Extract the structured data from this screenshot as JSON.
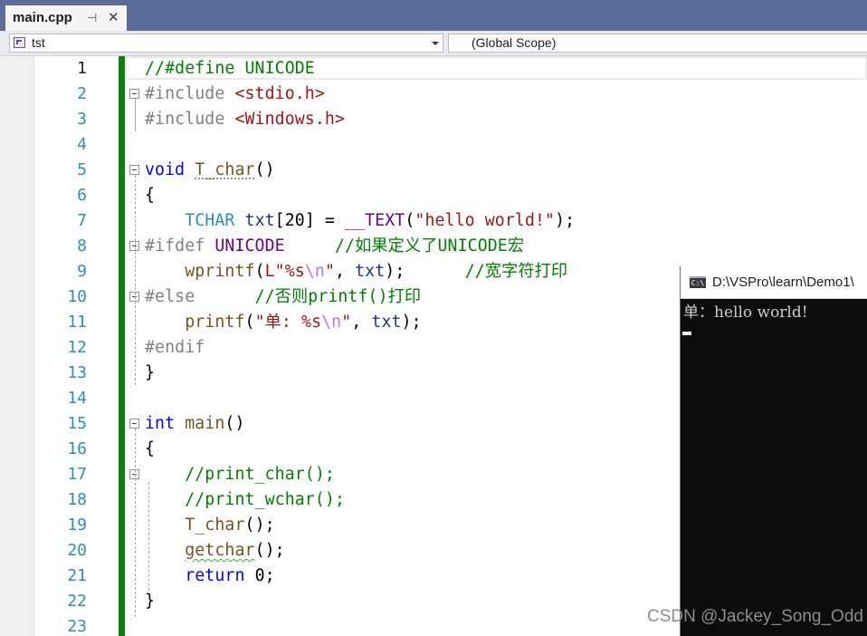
{
  "tab": {
    "title": "main.cpp",
    "pin_icon": "pin-icon",
    "close_icon": "close-icon"
  },
  "nav": {
    "project": "tst",
    "scope": "(Global Scope)"
  },
  "editor": {
    "current_line": 1,
    "lines": [
      {
        "n": "1",
        "fold": false,
        "tokens": [
          [
            "//#define UNICODE",
            "cm"
          ]
        ]
      },
      {
        "n": "2",
        "fold": true,
        "tokens": [
          [
            "#include ",
            "pp"
          ],
          [
            "<stdio.h>",
            "str"
          ]
        ]
      },
      {
        "n": "3",
        "fold": false,
        "tokens": [
          [
            "#include ",
            "pp"
          ],
          [
            "<Windows.h>",
            "str"
          ]
        ]
      },
      {
        "n": "4",
        "fold": false,
        "tokens": []
      },
      {
        "n": "5",
        "fold": true,
        "tokens": [
          [
            "void",
            "kw"
          ],
          [
            " ",
            "pl"
          ],
          [
            "T_char",
            "fn dot"
          ],
          [
            "()",
            "pl"
          ]
        ]
      },
      {
        "n": "6",
        "fold": false,
        "tokens": [
          [
            "{",
            "pl"
          ]
        ]
      },
      {
        "n": "7",
        "fold": false,
        "tokens": [
          [
            "    ",
            "pl"
          ],
          [
            "TCHAR",
            "typ"
          ],
          [
            " ",
            "pl"
          ],
          [
            "txt",
            "id"
          ],
          [
            "[20] = ",
            "pl"
          ],
          [
            "__TEXT",
            "mac"
          ],
          [
            "(",
            "pl"
          ],
          [
            "\"hello world!\"",
            "str"
          ],
          [
            ");",
            "pl"
          ]
        ]
      },
      {
        "n": "8",
        "fold": true,
        "tokens": [
          [
            "#ifdef ",
            "pp"
          ],
          [
            "UNICODE",
            "mac"
          ],
          [
            "     ",
            "pl"
          ],
          [
            "//如果定义了UNICODE宏",
            "cm"
          ]
        ]
      },
      {
        "n": "9",
        "fold": false,
        "tokens": [
          [
            "    ",
            "pl"
          ],
          [
            "wprintf",
            "fn"
          ],
          [
            "(",
            "pl"
          ],
          [
            "L\"%s",
            "str"
          ],
          [
            "\\n",
            "esc"
          ],
          [
            "\"",
            "str"
          ],
          [
            ", ",
            "pl"
          ],
          [
            "txt",
            "id"
          ],
          [
            ");",
            "pl"
          ],
          [
            "      ",
            "pl"
          ],
          [
            "//宽字符打印",
            "cm"
          ]
        ]
      },
      {
        "n": "10",
        "fold": true,
        "tokens": [
          [
            "#else",
            "pp"
          ],
          [
            "      ",
            "pl"
          ],
          [
            "//否则printf()打印",
            "cm"
          ]
        ]
      },
      {
        "n": "11",
        "fold": false,
        "tokens": [
          [
            "    ",
            "pl"
          ],
          [
            "printf",
            "fn"
          ],
          [
            "(",
            "pl"
          ],
          [
            "\"单: %s",
            "str"
          ],
          [
            "\\n",
            "esc"
          ],
          [
            "\"",
            "str"
          ],
          [
            ", ",
            "pl"
          ],
          [
            "txt",
            "id"
          ],
          [
            ");",
            "pl"
          ]
        ]
      },
      {
        "n": "12",
        "fold": false,
        "tokens": [
          [
            "#endif",
            "pp"
          ]
        ]
      },
      {
        "n": "13",
        "fold": false,
        "tokens": [
          [
            "}",
            "pl"
          ]
        ]
      },
      {
        "n": "14",
        "fold": false,
        "tokens": []
      },
      {
        "n": "15",
        "fold": true,
        "tokens": [
          [
            "int",
            "kw"
          ],
          [
            " ",
            "pl"
          ],
          [
            "main",
            "fn"
          ],
          [
            "()",
            "pl"
          ]
        ]
      },
      {
        "n": "16",
        "fold": false,
        "tokens": [
          [
            "{",
            "pl"
          ]
        ]
      },
      {
        "n": "17",
        "fold": true,
        "tokens": [
          [
            "    ",
            "pl"
          ],
          [
            "//print_char();",
            "cm"
          ]
        ]
      },
      {
        "n": "18",
        "fold": false,
        "tokens": [
          [
            "    ",
            "pl"
          ],
          [
            "//print_wchar();",
            "cm"
          ]
        ]
      },
      {
        "n": "19",
        "fold": false,
        "tokens": [
          [
            "    ",
            "pl"
          ],
          [
            "T_char",
            "fn"
          ],
          [
            "();",
            "pl"
          ]
        ]
      },
      {
        "n": "20",
        "fold": false,
        "tokens": [
          [
            "    ",
            "pl"
          ],
          [
            "getchar",
            "fn sq"
          ],
          [
            "();",
            "pl"
          ]
        ]
      },
      {
        "n": "21",
        "fold": false,
        "tokens": [
          [
            "    ",
            "pl"
          ],
          [
            "return",
            "kw"
          ],
          [
            " 0;",
            "pl"
          ]
        ]
      },
      {
        "n": "22",
        "fold": false,
        "tokens": [
          [
            "}",
            "pl"
          ]
        ]
      },
      {
        "n": "23",
        "fold": false,
        "tokens": []
      }
    ]
  },
  "console": {
    "icon_label": "C:\\",
    "title": "D:\\VSPro\\learn\\Demo1\\",
    "output": "单：hello world!"
  },
  "watermark": "CSDN @Jackey_Song_Odd",
  "colors": {
    "tabstrip": "#5d6b99",
    "keyword": "#0000ff",
    "preprocessor": "#808080",
    "string": "#a31515",
    "comment": "#008000",
    "macro": "#6f008a",
    "type": "#2b91af",
    "change_bar": "#108010",
    "console_bg": "#0c0c0c"
  }
}
